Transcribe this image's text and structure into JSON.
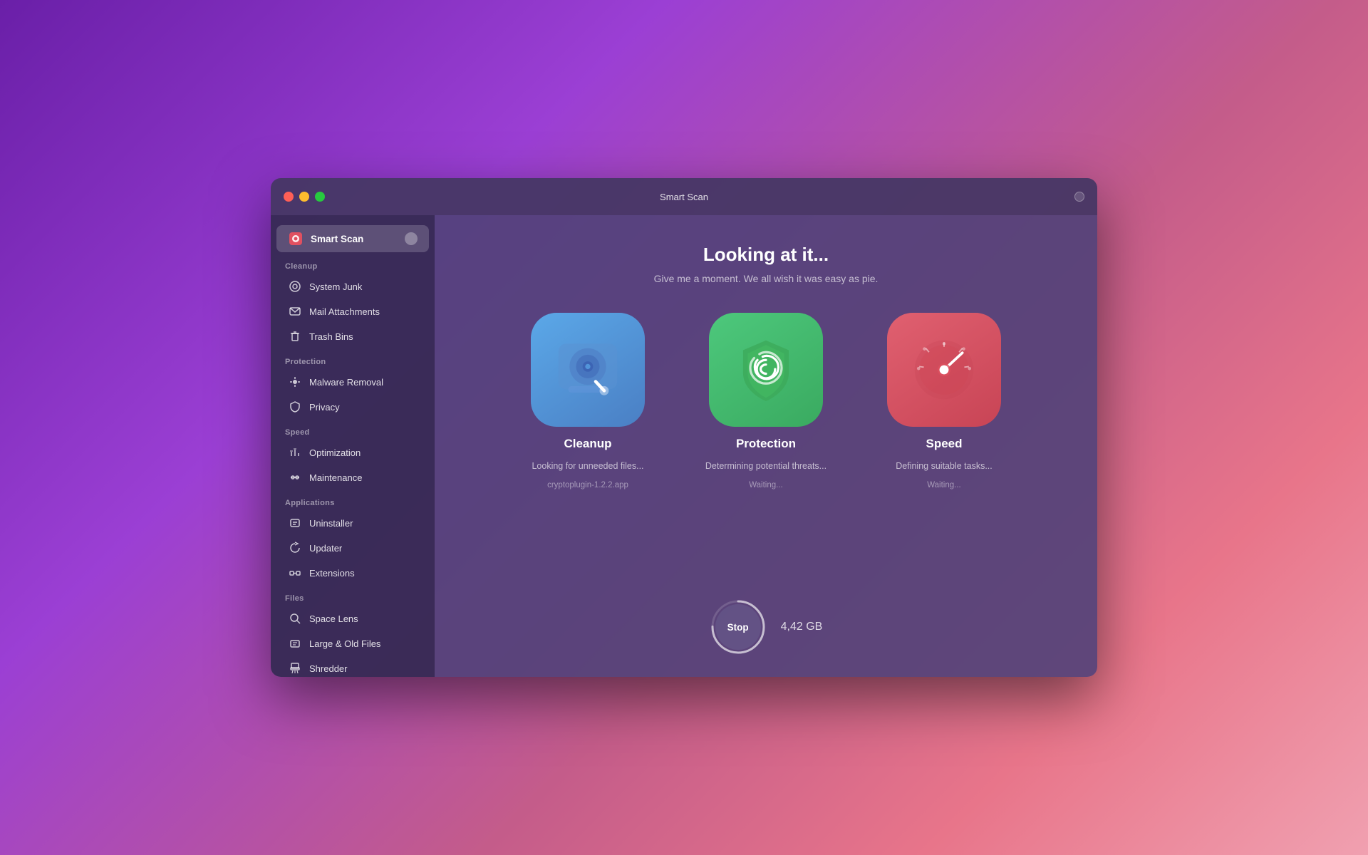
{
  "window": {
    "title": "Smart Scan"
  },
  "sidebar": {
    "smart_scan_label": "Smart Scan",
    "cleanup_section": "Cleanup",
    "system_junk": "System Junk",
    "mail_attachments": "Mail Attachments",
    "trash_bins": "Trash Bins",
    "protection_section": "Protection",
    "malware_removal": "Malware Removal",
    "privacy": "Privacy",
    "speed_section": "Speed",
    "optimization": "Optimization",
    "maintenance": "Maintenance",
    "applications_section": "Applications",
    "uninstaller": "Uninstaller",
    "updater": "Updater",
    "extensions": "Extensions",
    "files_section": "Files",
    "space_lens": "Space Lens",
    "large_old_files": "Large & Old Files",
    "shredder": "Shredder"
  },
  "main": {
    "heading": "Looking at it...",
    "subheading": "Give me a moment. We all wish it was easy as pie.",
    "cards": [
      {
        "name": "Cleanup",
        "status": "Looking for unneeded files...",
        "file": "cryptoplugin-1.2.2.app",
        "type": "cleanup"
      },
      {
        "name": "Protection",
        "status": "Determining potential threats...",
        "file": "Waiting...",
        "type": "protection"
      },
      {
        "name": "Speed",
        "status": "Defining suitable tasks...",
        "file": "Waiting...",
        "type": "speed"
      }
    ],
    "stop_button": "Stop",
    "scan_size": "4,42 GB"
  },
  "colors": {
    "accent": "#9b3fd4",
    "sidebar_bg": "#372a55",
    "content_bg": "#504178"
  }
}
